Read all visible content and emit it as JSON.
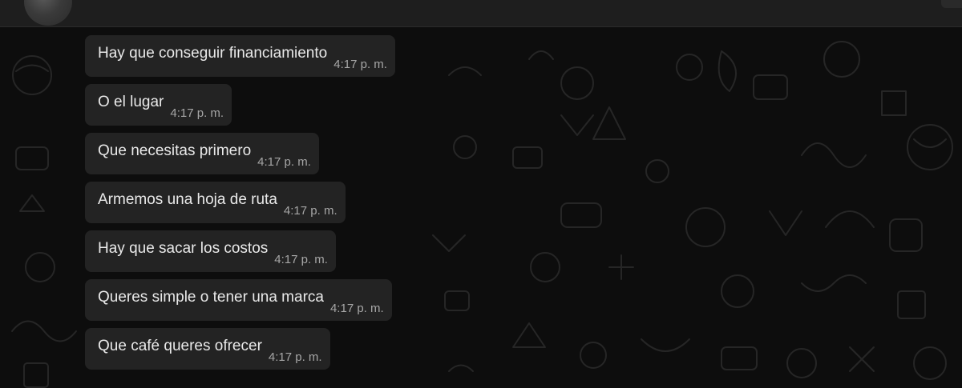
{
  "header": {
    "avatar": "contact-avatar"
  },
  "messages": [
    {
      "text": "Hay que conseguir financiamiento",
      "time": "4:17 p. m."
    },
    {
      "text": "O el lugar",
      "time": "4:17 p. m."
    },
    {
      "text": "Que necesitas primero",
      "time": "4:17 p. m."
    },
    {
      "text": "Armemos una hoja de ruta",
      "time": "4:17 p. m."
    },
    {
      "text": "Hay que sacar los costos",
      "time": "4:17 p. m."
    },
    {
      "text": "Queres simple o tener una marca",
      "time": "4:17 p. m."
    },
    {
      "text": "Que café queres ofrecer",
      "time": "4:17 p. m."
    }
  ],
  "colors": {
    "background": "#0d0d0d",
    "bubble": "#232323",
    "text": "#e9e9e9",
    "timestamp": "#a6a6a6"
  }
}
